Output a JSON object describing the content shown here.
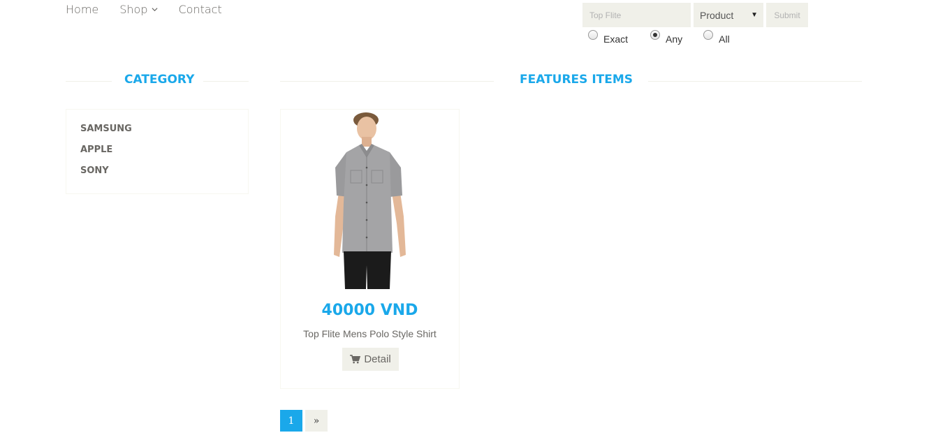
{
  "nav": {
    "items": [
      {
        "label": "Home"
      },
      {
        "label": "Shop"
      },
      {
        "label": "Contact"
      }
    ]
  },
  "search": {
    "placeholder": "Top Flite",
    "select_value": "Product",
    "submit_label": "Submit",
    "modes": [
      {
        "label": "Exact",
        "checked": false
      },
      {
        "label": "Any",
        "checked": true
      },
      {
        "label": "All",
        "checked": false
      }
    ]
  },
  "category": {
    "title": "CATEGORY",
    "items": [
      "SAMSUNG",
      "APPLE",
      "SONY"
    ]
  },
  "features": {
    "title": "FEATURES ITEMS"
  },
  "products": [
    {
      "price": "40000 VND",
      "name": "Top Flite Mens Polo Style Shirt",
      "detail_label": "Detail"
    }
  ],
  "pagination": {
    "current": "1",
    "next": "»"
  },
  "colors": {
    "accent": "#1aa8ea",
    "muted_bg": "#f0f0e9",
    "text": "#696763"
  }
}
